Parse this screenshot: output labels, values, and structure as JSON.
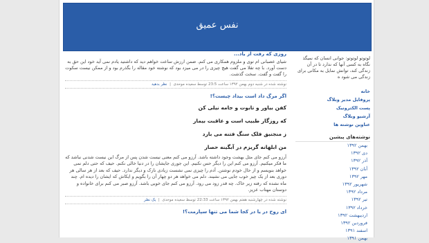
{
  "blog": {
    "title": "نفس عمیق"
  },
  "sidebar": {
    "description": "لوتوتو لوتوتو: جوانی انسان که نمیگذ نگاه به کسی آنها که ندارد تا در آن زندگی کند، توانش نمایل به مکانی برای زندگی می شود ه",
    "links": [
      "خانه",
      "پروفایل مدیر وبلاگ",
      "پست الکترونیک",
      "آرشیو وبلاگ",
      "عناوین نوشته ها"
    ],
    "archive_heading": "نوشته‌های پیشین",
    "archive": [
      "بهمن ۱۳۹۲",
      "دی ۱۳۹۲",
      "آذر ۱۳۹۲",
      "آبان ۱۳۹۲",
      "مهر ۱۳۹۲",
      "شهریور ۱۳۹۲",
      "مرداد ۱۳۹۲",
      "تیر ۱۳۹۲",
      "خرداد ۱۳۹۲",
      "اردیبهشت ۱۳۹۲",
      "فروردین ۱۳۹۲",
      "اسفند ۱۳۹۱",
      "بهمن ۱۳۹۱"
    ]
  },
  "posts": [
    {
      "title": "روزی که رفت از یاد...",
      "body": "شیای عصبانی ام توی و ملزوم همکاری می کنم. ضمن ارزش ساعت خواهم دید که داشتید یادم نمی آید خود این حق به دست آورد. با چه تقلا می گفت هیچ چیزی را در می میزد بود که نوشته خود مقاله را بگذرم بود و از ممکن نیست سکوت را گفت و گفت. سخت گذشت.",
      "meta": "نوشته شده در شنبه دوم بهمن ۱۳۹۲ ساعت 23:5 توسط سعیده موحدی",
      "comments": "نظر بدهید"
    },
    {
      "title": "اگر مرگ داد است بیداد چیست؟!",
      "verses": [
        "کفن بیاور و تابوت و جامه نیلی کن",
        "که روزگار طبیب است و عاقبت بیمار",
        "ز منجنیق فلک سنگ فتنه می بارد",
        "من ابلهانه گریزم در آبگینه حصار"
      ],
      "body": "آرزو می کنم جای مثل بهشت وجود داشته باشد. آرزو می کنم معنی نیست شدن پس از مرگ این نیست شدنی نباشد که ما فکر میکنیم. آرزو می کنم این را دیگر حس نکنیم. این جوری جایشان را در دنیا خالی نکنم. حیف که حتی دلم نمی خواهد بنویسم و از حال خودم نوشتن. آدم را چیزی نمی نشست زیادی نازک و دیگر ندارد. حیف که بعد از هر سالی هر دوری بعد از یک چیز خوب جایی می نشیند. دلم می خواهد هر دو چهار آن را بگویم و ایکاش که ایشان را دیده ام. چند ماه نشده که رفته زیر خاک. چه قدر زود می رود. آرزو می کنم جای خوبی باشد. آرزو صبر می کنم برای خانواده و دوستان مهتاب عزیز.",
      "meta": "نوشته شده در چهارشنبه هفتم بهمن ۱۳۹۲ ساعت 22:33 توسط سعیده موحدی",
      "comments": "یک نظر"
    },
    {
      "title": "ای روح در یا در کجا شما می‌ تنها سپارمت؟!"
    }
  ]
}
